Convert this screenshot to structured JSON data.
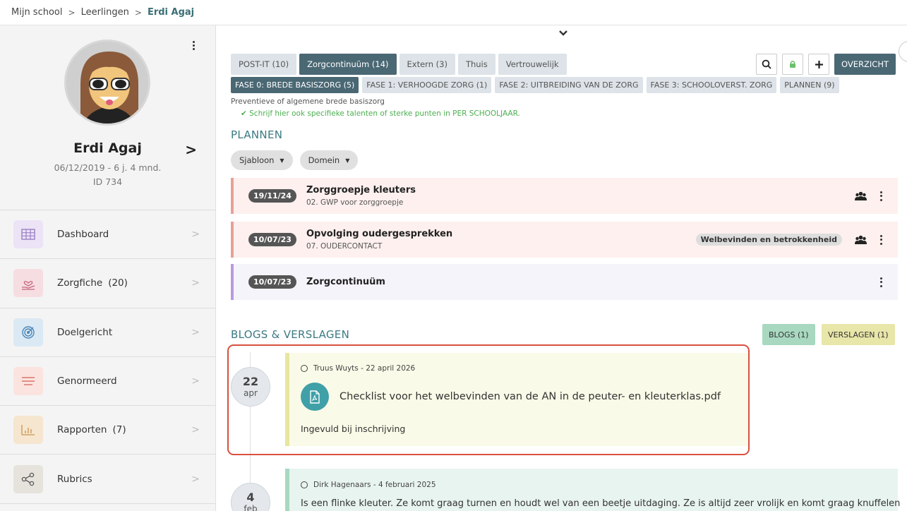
{
  "breadcrumb": {
    "items": [
      "Mijn school",
      "Leerlingen"
    ],
    "current": "Erdi Agaj"
  },
  "student": {
    "name": "Erdi Agaj",
    "dob": "06/12/2019 - 6 j. 4 mnd.",
    "id": "ID 734"
  },
  "nav": [
    {
      "label": "Dashboard",
      "count": "",
      "icon": "grid-icon",
      "bg": "#ece3f6",
      "fg": "#9b7fc4"
    },
    {
      "label": "Zorgfiche",
      "count": "(20)",
      "icon": "hand-heart-icon",
      "bg": "#f6dde2",
      "fg": "#c46479"
    },
    {
      "label": "Doelgericht",
      "count": "",
      "icon": "target-icon",
      "bg": "#dbe9f4",
      "fg": "#4b86b8"
    },
    {
      "label": "Genormeerd",
      "count": "",
      "icon": "lines-icon",
      "bg": "#fbe3df",
      "fg": "#d9746a"
    },
    {
      "label": "Rapporten",
      "count": "(7)",
      "icon": "bar-chart-icon",
      "bg": "#f6e6cf",
      "fg": "#c9954f"
    },
    {
      "label": "Rubrics",
      "count": "",
      "icon": "share-icon",
      "bg": "#e6e3dd",
      "fg": "#555555"
    }
  ],
  "tabs": [
    {
      "label": "POST-IT (10)",
      "active": false
    },
    {
      "label": "Zorgcontinuüm (14)",
      "active": true
    },
    {
      "label": "Extern (3)",
      "active": false
    },
    {
      "label": "Thuis",
      "active": false
    },
    {
      "label": "Vertrouwelijk",
      "active": false
    }
  ],
  "overview_label": "OVERZICHT",
  "phases": [
    {
      "label": "FASE 0: BREDE BASISZORG (5)",
      "active": true
    },
    {
      "label": "FASE 1: VERHOOGDE ZORG (1)",
      "active": false
    },
    {
      "label": "FASE 2: UITBREIDING VAN DE ZORG",
      "active": false
    },
    {
      "label": "FASE 3: SCHOOLOVERST. ZORG",
      "active": false
    },
    {
      "label": "PLANNEN (9)",
      "active": false
    }
  ],
  "phase_desc": "Preventieve of algemene brede basiszorg",
  "phase_tip": "✔ Schrijf hier ook specifieke talenten of sterke punten in PER SCHOOLJAAR.",
  "plannen": {
    "title": "PLANNEN",
    "filters": [
      "Sjabloon",
      "Domein"
    ],
    "items": [
      {
        "date": "19/11/24",
        "title": "Zorggroepje kleuters",
        "sub": "02. GWP voor zorggroepje",
        "tag": "",
        "group": true,
        "color": "pink"
      },
      {
        "date": "10/07/23",
        "title": "Opvolging oudergesprekken",
        "sub": "07. OUDERCONTACT",
        "tag": "Welbevinden en betrokkenheid",
        "group": true,
        "color": "pink"
      },
      {
        "date": "10/07/23",
        "title": "Zorgcontinuüm",
        "sub": "",
        "tag": "",
        "group": false,
        "color": "lilac"
      }
    ]
  },
  "blogs": {
    "title": "BLOGS & VERSLAGEN",
    "blogs_label": "BLOGS (1)",
    "verslagen_label": "VERSLAGEN (1)",
    "entries": [
      {
        "day": "22",
        "month": "apr",
        "author": "Truus Wuyts - 22 april 2026",
        "attachment": "Checklist voor het welbevinden van de AN in de peuter- en kleuterklas.pdf",
        "note": "Ingevuld bij inschrijving"
      },
      {
        "day": "4",
        "month": "feb",
        "author": "Dirk Hagenaars - 4 februari 2025",
        "text": "Is een flinke kleuter. Ze komt graag turnen en houdt wel van een beetje uitdaging. Ze is altijd zeer vrolijk en komt graag knuffelen"
      }
    ]
  }
}
